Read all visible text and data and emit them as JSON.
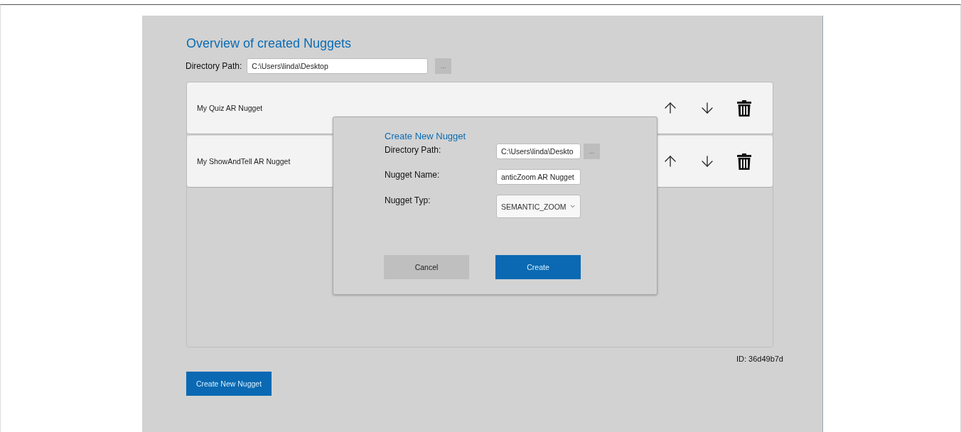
{
  "header": {
    "title": "Overview of created Nuggets",
    "directory_label": "Directory Path:",
    "directory_value": "C:\\Users\\linda\\Desktop",
    "browse_button": "..."
  },
  "nuggets": [
    {
      "name": "My Quiz AR Nugget"
    },
    {
      "name": "My ShowAndTell AR Nugget"
    }
  ],
  "id_label": "ID: 36d49b7d",
  "create_button": "Create New Nugget",
  "dialog": {
    "title": "Create New Nugget",
    "fields": [
      {
        "kind": "path",
        "label": "Directory Path:",
        "value": "C:\\Users\\linda\\Deskto",
        "button": "..."
      },
      {
        "kind": "text",
        "label": "Nugget Name:",
        "value": "anticZoom AR Nugget"
      },
      {
        "kind": "select",
        "label": "Nugget Typ:",
        "value": "SEMANTIC_ZOOM"
      }
    ],
    "buttons": [
      {
        "kind": "secondary",
        "label": "Cancel"
      },
      {
        "kind": "primary",
        "label": "Create"
      }
    ]
  }
}
